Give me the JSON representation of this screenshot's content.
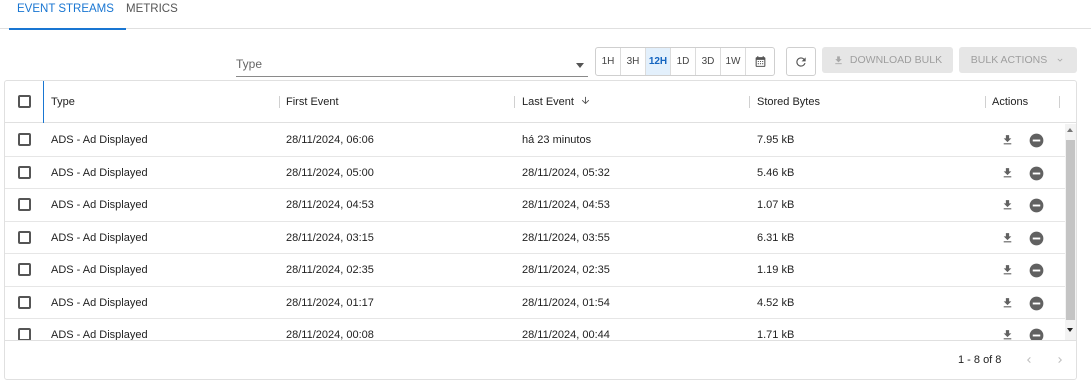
{
  "tabs": [
    {
      "label": "EVENT STREAMS",
      "active": true
    },
    {
      "label": "METRICS",
      "active": false
    }
  ],
  "toolbar": {
    "type_placeholder": "Type",
    "ranges": [
      "1H",
      "3H",
      "12H",
      "1D",
      "3D",
      "1W"
    ],
    "active_range": "12H",
    "download_label": "DOWNLOAD BULK",
    "bulk_actions_label": "BULK ACTIONS"
  },
  "table": {
    "columns": {
      "type": "Type",
      "first_event": "First Event",
      "last_event": "Last Event",
      "stored_bytes": "Stored Bytes",
      "actions": "Actions"
    },
    "sorted_column": "last_event",
    "sort_direction": "desc",
    "rows": [
      {
        "type": "ADS - Ad Displayed",
        "first_event": "28/11/2024, 06:06",
        "last_event": "há 23 minutos",
        "stored_bytes": "7.95 kB"
      },
      {
        "type": "ADS - Ad Displayed",
        "first_event": "28/11/2024, 05:00",
        "last_event": "28/11/2024, 05:32",
        "stored_bytes": "5.46 kB"
      },
      {
        "type": "ADS - Ad Displayed",
        "first_event": "28/11/2024, 04:53",
        "last_event": "28/11/2024, 04:53",
        "stored_bytes": "1.07 kB"
      },
      {
        "type": "ADS - Ad Displayed",
        "first_event": "28/11/2024, 03:15",
        "last_event": "28/11/2024, 03:55",
        "stored_bytes": "6.31 kB"
      },
      {
        "type": "ADS - Ad Displayed",
        "first_event": "28/11/2024, 02:35",
        "last_event": "28/11/2024, 02:35",
        "stored_bytes": "1.19 kB"
      },
      {
        "type": "ADS - Ad Displayed",
        "first_event": "28/11/2024, 01:17",
        "last_event": "28/11/2024, 01:54",
        "stored_bytes": "4.52 kB"
      },
      {
        "type": "ADS - Ad Displayed",
        "first_event": "28/11/2024, 00:08",
        "last_event": "28/11/2024, 00:44",
        "stored_bytes": "1.71 kB"
      }
    ]
  },
  "pagination": {
    "range_text": "1 - 8 of 8"
  },
  "colors": {
    "accent": "#1976d2",
    "disabled_bg": "#e6e6e6",
    "icon": "#616161"
  },
  "icons": [
    "calendar-icon",
    "refresh-icon",
    "download-icon",
    "chevron-down-icon",
    "arrow-down-icon",
    "remove-circle-icon",
    "chevron-left-icon",
    "chevron-right-icon"
  ]
}
